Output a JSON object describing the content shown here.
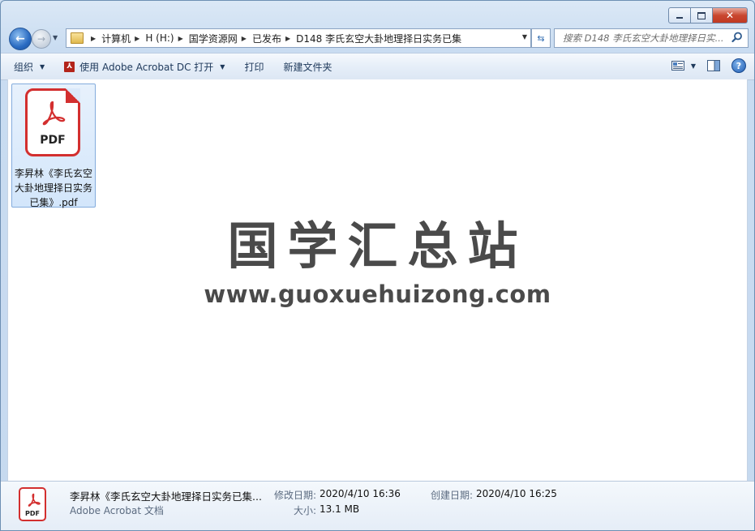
{
  "window": {
    "controls": {
      "minimize": "minimize",
      "restore": "restore",
      "close": "✕"
    }
  },
  "nav": {
    "breadcrumb": [
      "计算机",
      "H (H:)",
      "国学资源网",
      "已发布",
      "D148 李氏玄空大卦地理择日实务已集"
    ],
    "search_placeholder": "搜索 D148 李氏玄空大卦地理择日实..."
  },
  "toolbar": {
    "organize": "组织",
    "open_with": "使用 Adobe Acrobat DC 打开",
    "print": "打印",
    "new_folder": "新建文件夹"
  },
  "files": [
    {
      "name": "李昇林《李氏玄空大卦地理择日实务已集》.pdf",
      "icon_text": "PDF",
      "selected": true
    }
  ],
  "watermark": {
    "title": "国学汇总站",
    "url": "www.guoxuehuizong.com"
  },
  "details": {
    "name": "李昇林《李氏玄空大卦地理择日实务已集...",
    "type": "Adobe Acrobat 文档",
    "modified_label": "修改日期:",
    "modified_value": "2020/4/10 16:36",
    "created_label": "创建日期:",
    "created_value": "2020/4/10 16:25",
    "size_label": "大小:",
    "size_value": "13.1 MB",
    "icon_text": "PDF"
  }
}
